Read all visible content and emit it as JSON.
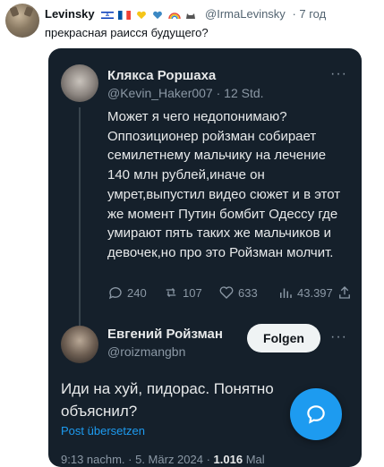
{
  "post": {
    "username": "Levinsky",
    "handle": "@IrmaLevinsky",
    "time": "· 7 год",
    "text": "прекрасная раисся будущего?"
  },
  "quote": {
    "author_name": "Клякса Роршаха",
    "author_handle": "@Kevin_Haker007 · 12 Std.",
    "more": "···",
    "body": "Может я чего недопонимаю? Оппозиционер ройзман собирает семилетнему мальчику на лечение 140 млн рублей,иначе он умрет,выпустил видео сюжет и в этот же момент Путин бомбит Одессу где умирают пять таких же мальчиков и девочек,но про это Ройзман молчит.",
    "replies": "240",
    "reposts": "107",
    "likes": "633",
    "views": "43.397"
  },
  "reply": {
    "author_name": "Евгений Ройзман",
    "author_handle": "@roizmangbn",
    "follow_label": "Folgen",
    "more": "···",
    "body": "Иди на хуй, пидорас. Понятно объяснил?",
    "translate_link": "Post übersetzen",
    "meta_time": "9:13 nachm. · 5. März 2024 · ",
    "meta_views": "1.016",
    "meta_views_label": " Mal"
  },
  "colors": {
    "card_bg": "#15202b",
    "accent": "#1d9bf0",
    "muted": "#8b98a5"
  }
}
